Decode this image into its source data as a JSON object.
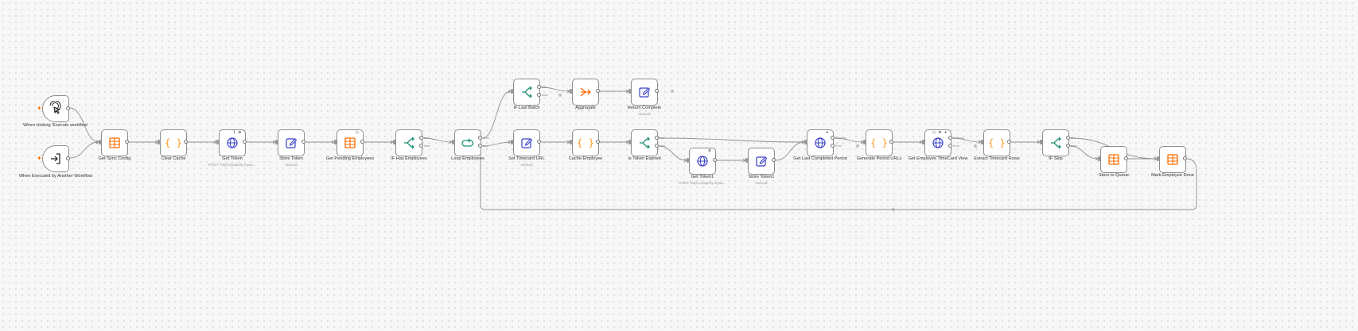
{
  "colors": {
    "table": "#ff6d00",
    "code": "#ff9922",
    "http": "#3a41c9",
    "set": "#3a41c9",
    "if": "#1f8f77",
    "loop": "#1f8f77",
    "trigger": "#222222",
    "bolt": "#ff6d00"
  },
  "nodes": [
    {
      "id": "trig1",
      "label": "When clicking 'Execute workflow'",
      "icon": "cursor-click-icon",
      "kind": "trigger"
    },
    {
      "id": "trig2",
      "label": "When Executed by Another Workflow",
      "icon": "sign-in-icon",
      "kind": "trigger"
    },
    {
      "id": "sync",
      "label": "Get Sync Config",
      "icon": "table-icon",
      "kind": "table"
    },
    {
      "id": "clear",
      "label": "Clear Cache",
      "icon": "braces-icon",
      "kind": "code"
    },
    {
      "id": "token",
      "label": "Get Token",
      "sub": "POST: https://paperly.myau...",
      "icon": "globe-icon",
      "kind": "http",
      "badge": "1 ⚙"
    },
    {
      "id": "store",
      "label": "Store Token",
      "sub": "manual",
      "icon": "pencil-icon",
      "kind": "set"
    },
    {
      "id": "pend",
      "label": "Get Pending Employees",
      "icon": "table-icon",
      "kind": "table",
      "badge": "○"
    },
    {
      "id": "ifhas",
      "label": "IF Has Employees",
      "icon": "if-icon",
      "kind": "if",
      "outs": [
        "true",
        "false"
      ]
    },
    {
      "id": "loop",
      "label": "Loop Employees",
      "icon": "loop-icon",
      "kind": "loop",
      "outs": [
        "done",
        "loop"
      ]
    },
    {
      "id": "iflast",
      "label": "IF Last Batch",
      "icon": "if-icon",
      "kind": "if",
      "outs": [
        "true",
        "false"
      ]
    },
    {
      "id": "agg",
      "label": "Aggregate",
      "icon": "aggregate-icon",
      "kind": "table"
    },
    {
      "id": "ret",
      "label": "Return Complete",
      "sub": "manual",
      "icon": "pencil-icon",
      "kind": "set"
    },
    {
      "id": "seturl",
      "label": "Set Timecard URL",
      "sub": "manual",
      "icon": "pencil-icon",
      "kind": "set"
    },
    {
      "id": "cache",
      "label": "Cache Employee",
      "icon": "braces-icon",
      "kind": "code"
    },
    {
      "id": "isexp",
      "label": "Is Token Expired",
      "icon": "if-icon",
      "kind": "if",
      "outs": [
        "true",
        "false"
      ]
    },
    {
      "id": "tok1",
      "label": "Get Token1",
      "sub": "POST: https://paperly.myau...",
      "icon": "globe-icon",
      "kind": "http",
      "badge": "⚙"
    },
    {
      "id": "store1",
      "label": "Store Token1",
      "sub": "manual",
      "icon": "pencil-icon",
      "kind": "set"
    },
    {
      "id": "lastp",
      "label": "Get Last Completed Period",
      "icon": "globe-icon",
      "kind": "http",
      "badge": "✈",
      "outs": [
        "Success",
        "Error"
      ]
    },
    {
      "id": "gen",
      "label": "Generate Period URLs",
      "icon": "braces-icon",
      "kind": "code"
    },
    {
      "id": "emptc",
      "label": "Get Employee TimeCard View",
      "icon": "globe-icon",
      "kind": "http",
      "badge": "○ ⚙ ✈",
      "outs": [
        "Success",
        "Error"
      ]
    },
    {
      "id": "extr",
      "label": "Extract Timecard Rows",
      "icon": "braces-icon",
      "kind": "code"
    },
    {
      "id": "ifskip",
      "label": "IF Skip",
      "icon": "if-icon",
      "kind": "if",
      "outs": [
        "true",
        "false"
      ]
    },
    {
      "id": "queue",
      "label": "Store to Queue",
      "icon": "table-icon",
      "kind": "table"
    },
    {
      "id": "done",
      "label": "Mark Employee Done",
      "icon": "table-icon",
      "kind": "table"
    }
  ]
}
